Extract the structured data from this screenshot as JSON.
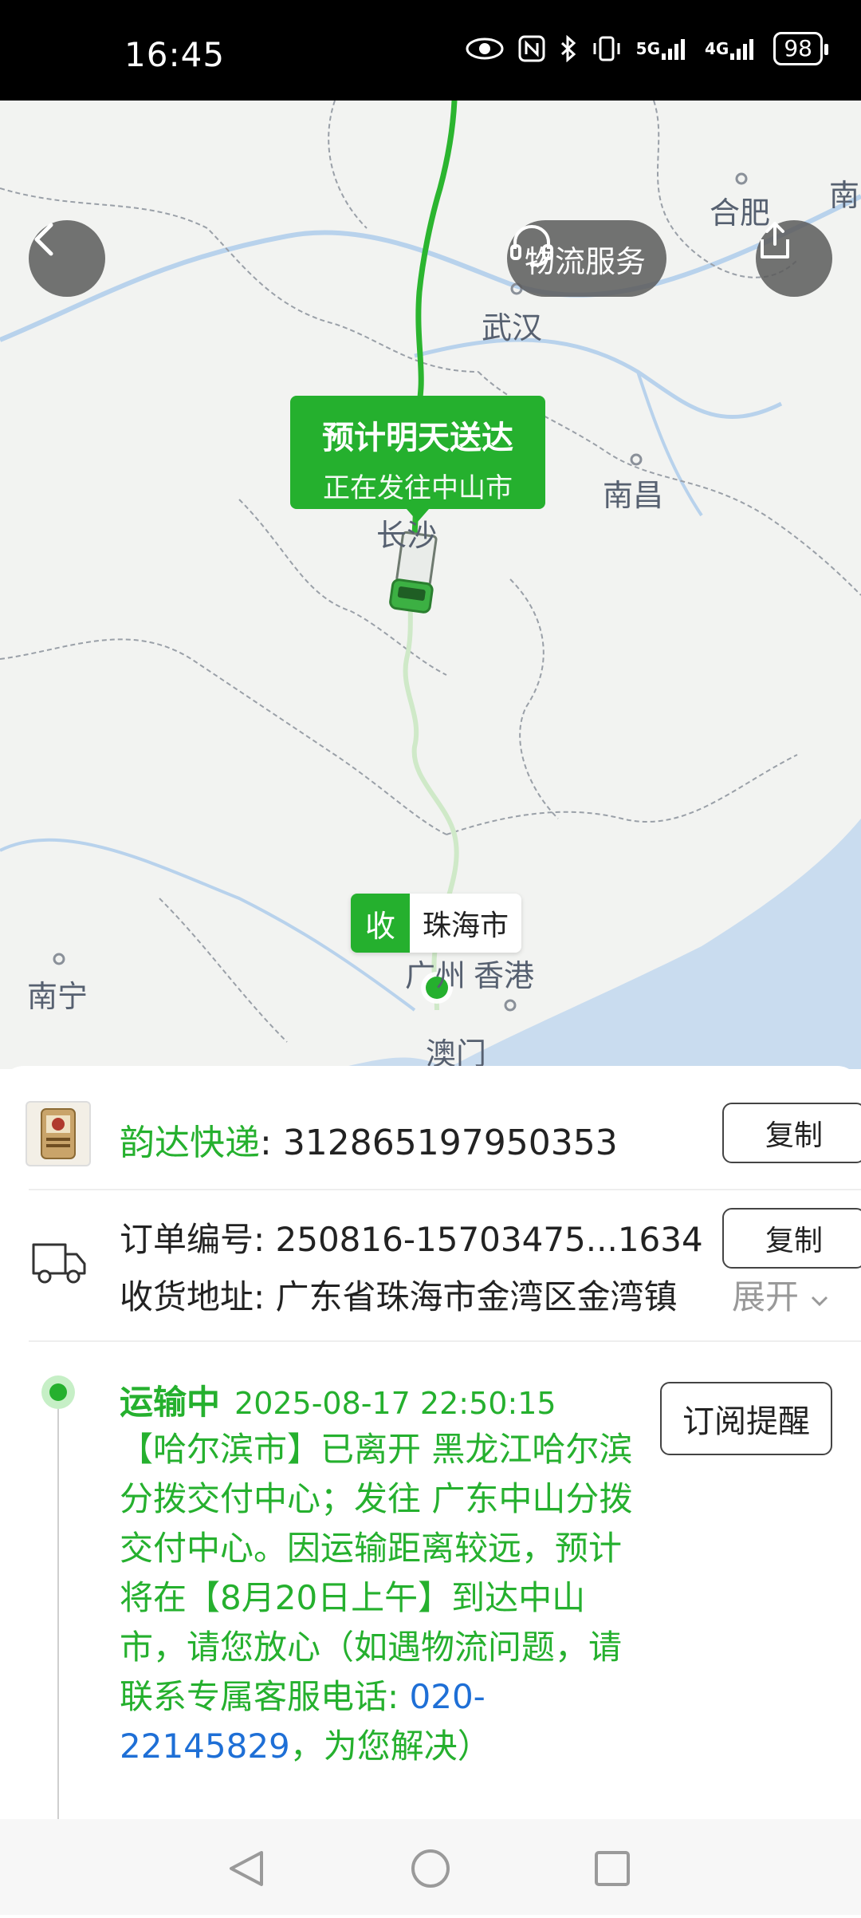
{
  "status_bar": {
    "time": "16:45",
    "network1": "5G",
    "network2": "4G",
    "battery": "98"
  },
  "map": {
    "cities": [
      "合肥",
      "南",
      "武汉",
      "南昌",
      "长沙",
      "南宁",
      "广州",
      "香港",
      "澳门"
    ],
    "eta_title": "预计明天送达",
    "eta_subtitle": "正在发往中山市",
    "dest_tag": "收",
    "dest_name": "珠海市",
    "service_label": "物流服务"
  },
  "package": {
    "carrier": "韵达快递",
    "separator": ": ",
    "tracking_number": "312865197950353",
    "copy_label": "复制"
  },
  "order": {
    "order_label": "订单编号: ",
    "order_number": "250816-15703475...1634",
    "copy_label": "复制",
    "address_label": "收货地址: ",
    "address": "广东省珠海市金湾区金湾镇",
    "expand_label": "展开"
  },
  "tracking": {
    "status": "运输中",
    "timestamp": "2025-08-17 22:50:15",
    "subscribe_label": "订阅提醒",
    "detail_text": "【哈尔滨市】已离开 黑龙江哈尔滨分拨交付中心；发往 广东中山分拨交付中心。因运输距离较远，预计将在【8月20日上午】到达中山市，请您放心（如遇物流问题，请联系专属客服电话: ",
    "phone": "020-22145829",
    "detail_tail": "，为您解决）"
  },
  "colors": {
    "accent_green": "#25b02e",
    "link_blue": "#1e6fd6",
    "status_bar_bg": "#000000"
  },
  "icons": [
    "eye-icon",
    "nfc-icon",
    "bluetooth-icon",
    "vibrate-icon",
    "signal-icon",
    "battery-icon",
    "back-arrow-icon",
    "headset-icon",
    "share-icon",
    "truck-icon",
    "nav-back-icon",
    "nav-home-icon",
    "nav-recents-icon"
  ]
}
